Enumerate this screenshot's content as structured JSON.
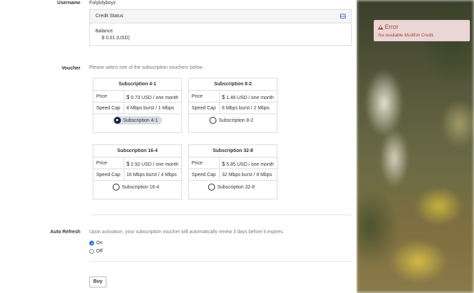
{
  "labels": {
    "username": "Username",
    "voucher": "Voucher",
    "auto_refresh": "Auto Refresh"
  },
  "username_value": "Folylolyboyz",
  "credit": {
    "title": "Credit Status",
    "balance_label": "Balance",
    "balance_value": "$ 0.01 (USD)"
  },
  "voucher_hint": "Please select one of the subscription vouchers below.",
  "vouchers": [
    {
      "title": "Subscription 4-1",
      "price_label": "Price",
      "price_currency": "$",
      "price": "0.73 USD / one month",
      "speed_label": "Speed Cap",
      "speed": "4 Mbps burst / 1 Mbps",
      "radio_label": "Subscription 4-1"
    },
    {
      "title": "Subscription 8-2",
      "price_label": "Price",
      "price_currency": "$",
      "price": "1.46 USD / one month",
      "speed_label": "Speed Cap",
      "speed": "8 Mbps burst / 2 Mbps",
      "radio_label": "Subscription 8-2"
    },
    {
      "title": "Subscription 16-4",
      "price_label": "Price",
      "price_currency": "$",
      "price": "2.92 USD / one month",
      "speed_label": "Speed Cap",
      "speed": "16 Mbps burst / 4 Mbps",
      "radio_label": "Subscription 16-4"
    },
    {
      "title": "Subscription 32-8",
      "price_label": "Price",
      "price_currency": "$",
      "price": "5.85 USD / one month",
      "speed_label": "Speed Cap",
      "speed": "32 Mbps burst / 8 Mbps",
      "radio_label": "Subscription 32-8"
    }
  ],
  "auto_refresh": {
    "text": "Upon activation, your subscription voucher will automatically renew 3 days before it expires.",
    "on_label": "On",
    "off_label": "Off"
  },
  "buy_label": "Buy",
  "alert": {
    "title": "Error",
    "message": "No available Mudfish Credit."
  }
}
